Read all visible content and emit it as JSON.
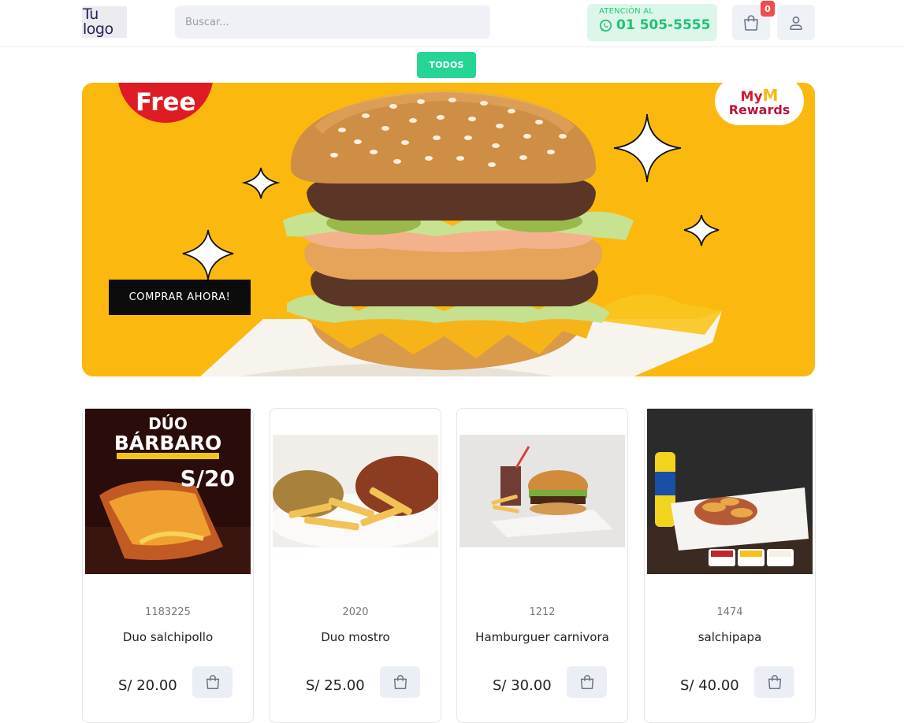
{
  "header": {
    "logo_line1": "Tu",
    "logo_line2": "logo",
    "search_placeholder": "Buscar...",
    "atencion_label": "ATENCIÓN AL",
    "phone": "01 505-5555",
    "cart_count": "0"
  },
  "categories": [
    {
      "label": "TODOS"
    }
  ],
  "banner": {
    "free_text": "Free",
    "rewards_my": "My",
    "rewards_m": "M",
    "rewards_text": "Rewards",
    "cta": "COMPRAR AHORA!"
  },
  "products": [
    {
      "code": "1183225",
      "name": "Duo salchipollo",
      "price": "S/ 20.00",
      "promo_title1": "DÚO",
      "promo_title2": "BÁRBARO",
      "promo_price": "S/20"
    },
    {
      "code": "2020",
      "name": "Duo mostro",
      "price": "S/ 25.00"
    },
    {
      "code": "1212",
      "name": "Hamburguer carnivora",
      "price": "S/ 30.00"
    },
    {
      "code": "1474",
      "name": "salchipapa",
      "price": "S/ 40.00"
    }
  ],
  "colors": {
    "accent_green": "#25d594",
    "banner_yellow": "#fbb90f",
    "badge_red": "#f24b4b"
  }
}
